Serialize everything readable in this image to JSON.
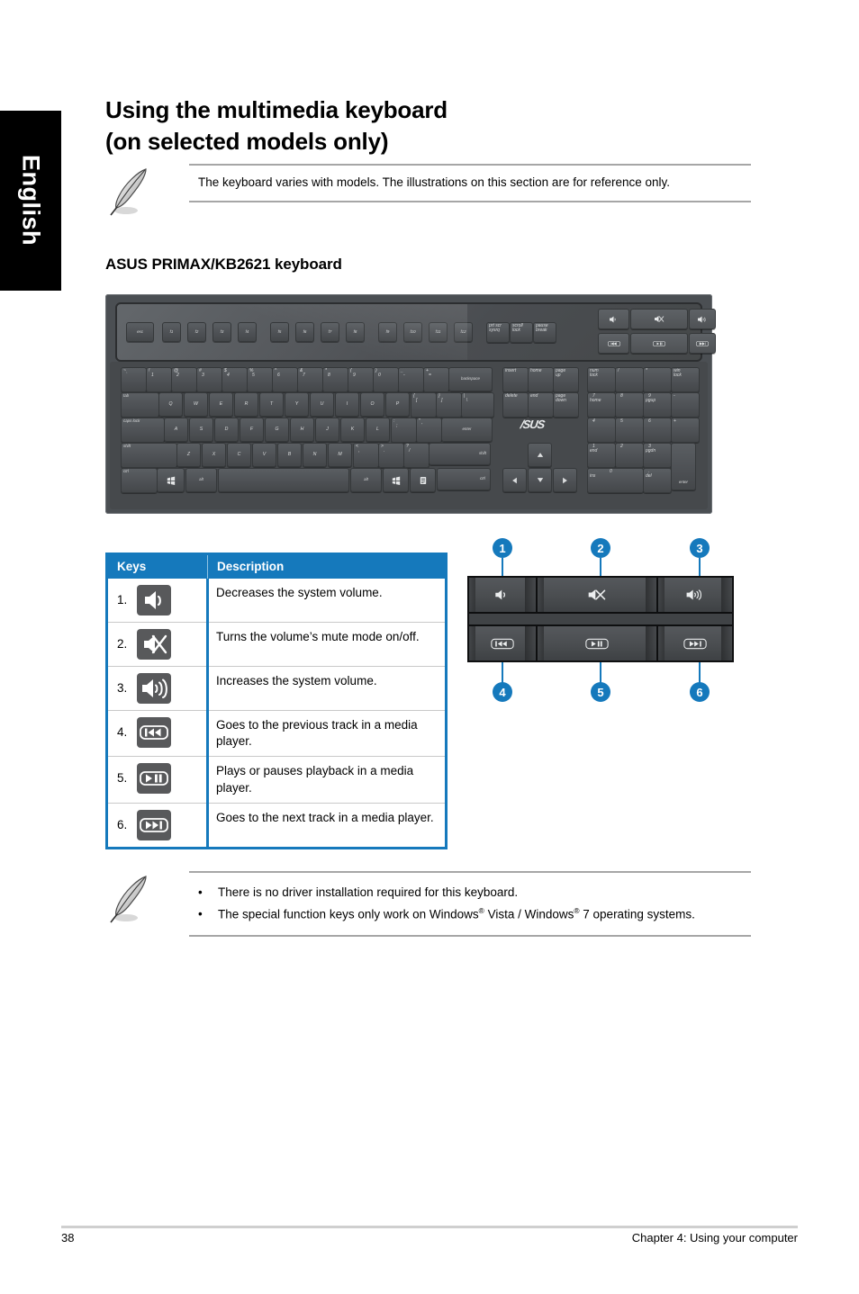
{
  "language_tab": {
    "label": "English"
  },
  "page_title": {
    "line1": "Using the multimedia keyboard",
    "line2": "(on selected models only)"
  },
  "note_top": {
    "icon": "feather-note-icon",
    "text": "The keyboard varies with models. The illustrations on this section are for reference only."
  },
  "section_title": "ASUS PRIMAX/KB2621 keyboard",
  "keyboard_figure": {
    "brand": "/SUS",
    "function_row": [
      "esc",
      "f1",
      "f2",
      "f3",
      "f4",
      "f5",
      "f6",
      "f7",
      "f8",
      "f9",
      "f10",
      "f11",
      "f12"
    ],
    "system_keys": [
      {
        "l1": "prt scr",
        "l2": "sysrq"
      },
      {
        "l1": "scroll",
        "l2": "lock"
      },
      {
        "l1": "pause",
        "l2": "break"
      }
    ],
    "media_row_top": [
      "volume-down-icon",
      "mute-icon",
      "volume-up-icon"
    ],
    "media_row_bottom": [
      "prev-track-icon",
      "play-pause-icon",
      "next-track-icon"
    ],
    "number_row": [
      {
        "top": "~",
        "bottom": "`"
      },
      {
        "top": "!",
        "bottom": "1"
      },
      {
        "top": "@",
        "bottom": "2"
      },
      {
        "top": "#",
        "bottom": "3"
      },
      {
        "top": "$",
        "bottom": "4"
      },
      {
        "top": "%",
        "bottom": "5"
      },
      {
        "top": "^",
        "bottom": "6"
      },
      {
        "top": "&",
        "bottom": "7"
      },
      {
        "top": "*",
        "bottom": "8"
      },
      {
        "top": "(",
        "bottom": "9"
      },
      {
        "top": ")",
        "bottom": "0"
      },
      {
        "top": "_",
        "bottom": "-"
      },
      {
        "top": "+",
        "bottom": "="
      }
    ],
    "backspace": "backspace",
    "tab": "tab",
    "qwerty_row": [
      "Q",
      "W",
      "E",
      "R",
      "T",
      "Y",
      "U",
      "I",
      "O",
      "P"
    ],
    "bracket_keys": [
      {
        "top": "{",
        "bottom": "["
      },
      {
        "top": "}",
        "bottom": "]"
      },
      {
        "top": "|",
        "bottom": "\\"
      }
    ],
    "caps_lock": "caps lock",
    "asdf_row": [
      "A",
      "S",
      "D",
      "F",
      "G",
      "H",
      "J",
      "K",
      "L"
    ],
    "punct_keys": [
      {
        "top": ":",
        "bottom": ";"
      },
      {
        "top": "\"",
        "bottom": "'"
      }
    ],
    "enter": "enter",
    "shift_left": "shift",
    "zxcv_row": [
      "Z",
      "X",
      "C",
      "V",
      "B",
      "N",
      "M"
    ],
    "comma_keys": [
      {
        "top": "<",
        "bottom": ","
      },
      {
        "top": ">",
        "bottom": "."
      },
      {
        "top": "?",
        "bottom": "/"
      }
    ],
    "shift_right": "shift",
    "ctrl_left": "ctrl",
    "alt_left": "alt",
    "alt_right": "alt",
    "ctrl_right": "ctrl",
    "nav_cluster_1": [
      {
        "l1": "insert"
      },
      {
        "l1": "home"
      },
      {
        "l1": "page",
        "l2": "up"
      }
    ],
    "nav_cluster_2": [
      {
        "l1": "delete"
      },
      {
        "l1": "end"
      },
      {
        "l1": "page",
        "l2": "down"
      }
    ],
    "numpad_row1": [
      {
        "l1": "num",
        "l2": "lock"
      },
      {
        "l1": "/"
      },
      {
        "l1": "*"
      },
      {
        "l1": "win",
        "l2": "lock"
      }
    ],
    "numpad_row2": [
      {
        "l1": "7",
        "l2": "home"
      },
      {
        "l1": "8"
      },
      {
        "l1": "9",
        "l2": "pgup"
      },
      {
        "l1": "-"
      }
    ],
    "numpad_row3": [
      {
        "l1": "4"
      },
      {
        "l1": "5"
      },
      {
        "l1": "6"
      },
      {
        "l1": "+"
      }
    ],
    "numpad_row4": [
      {
        "l1": "1",
        "l2": "end"
      },
      {
        "l1": "2"
      },
      {
        "l1": "3",
        "l2": "pgdn"
      }
    ],
    "numpad_row5": [
      {
        "l1": "0",
        "l2": "ins"
      },
      {
        "l1": ".",
        "l2": "del"
      },
      {
        "l1": "enter"
      }
    ]
  },
  "table": {
    "headers": {
      "keys": "Keys",
      "description": "Description"
    },
    "rows": [
      {
        "num": "1.",
        "icon": "volume-down-icon",
        "description": "Decreases the system volume."
      },
      {
        "num": "2.",
        "icon": "mute-icon",
        "description": "Turns the volume’s mute mode on/off."
      },
      {
        "num": "3.",
        "icon": "volume-up-icon",
        "description": "Increases the system volume."
      },
      {
        "num": "4.",
        "icon": "previous-track-icon",
        "description": "Goes to the previous track in a media player."
      },
      {
        "num": "5.",
        "icon": "play-pause-icon",
        "description": "Plays or pauses playback in a media player."
      },
      {
        "num": "6.",
        "icon": "next-track-icon",
        "description": "Goes to the next track in a media player."
      }
    ],
    "accent_color": "#1579BC"
  },
  "callout_figure": {
    "callouts": [
      "1",
      "2",
      "3",
      "4",
      "5",
      "6"
    ],
    "buttons": {
      "top": [
        "volume-down-icon",
        "mute-icon",
        "volume-up-icon"
      ],
      "bottom": [
        "previous-track-icon",
        "play-pause-icon",
        "next-track-icon"
      ]
    },
    "accent_color": "#1579BC"
  },
  "note_bottom": {
    "icon": "feather-note-icon",
    "bullet_char": "•",
    "bullets": [
      {
        "text": "There is no driver installation required for this keyboard."
      }
    ],
    "bullet2": {
      "pre": "The special function keys only work on Windows",
      "sup1": "®",
      "mid": " Vista / Windows",
      "sup2": "®",
      "post": " 7 operating systems."
    }
  },
  "footer": {
    "page_number": "38",
    "chapter": "Chapter 4: Using your computer"
  }
}
